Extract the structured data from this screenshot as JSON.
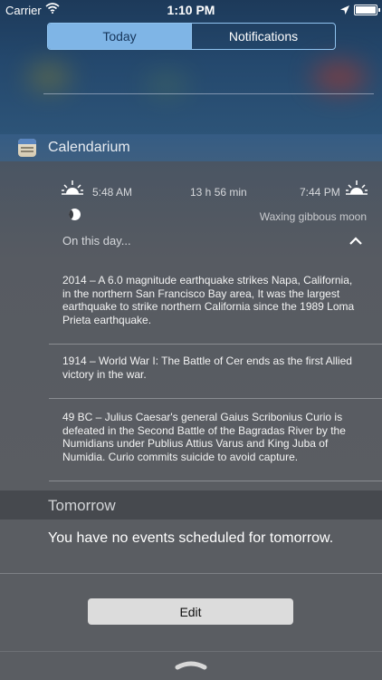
{
  "status_bar": {
    "carrier": "Carrier",
    "time": "1:10 PM"
  },
  "segmented": {
    "today": "Today",
    "notifications": "Notifications"
  },
  "widget": {
    "app_name": "Calendarium",
    "sunrise": "5:48 AM",
    "day_length": "13 h 56 min",
    "sunset": "7:44 PM",
    "moon_phase": "Waxing gibbous moon",
    "on_this_day_label": "On this day...",
    "events": [
      {
        "text": "2014 – A 6.0 magnitude earthquake strikes Napa, California, in the northern San Francisco Bay area, It was the largest earthquake to strike northern California since the 1989 Loma Prieta earthquake."
      },
      {
        "text": "1914 – World War I: The Battle of Cer ends as the first Allied victory in the war."
      },
      {
        "text": "49 BC – Julius Caesar's general Gaius Scribonius Curio is defeated in the Second Battle of the Bagradas River by the Numidians under Publius Attius Varus and King Juba of Numidia. Curio commits suicide to avoid capture."
      }
    ]
  },
  "tomorrow": {
    "title": "Tomorrow",
    "message": "You have no events scheduled for tomorrow."
  },
  "edit_label": "Edit",
  "colors": {
    "segment_active": "#7fb5e6",
    "header_blue": "#355c84",
    "background": "#5a5d62"
  },
  "icons": {
    "wifi": "wifi-icon",
    "location": "location-arrow-icon",
    "battery": "battery-icon",
    "sunrise": "sunrise-icon",
    "sunset": "sunset-icon",
    "moon": "moon-icon",
    "collapse": "chevron-up-icon",
    "grabber": "grabber-icon"
  }
}
